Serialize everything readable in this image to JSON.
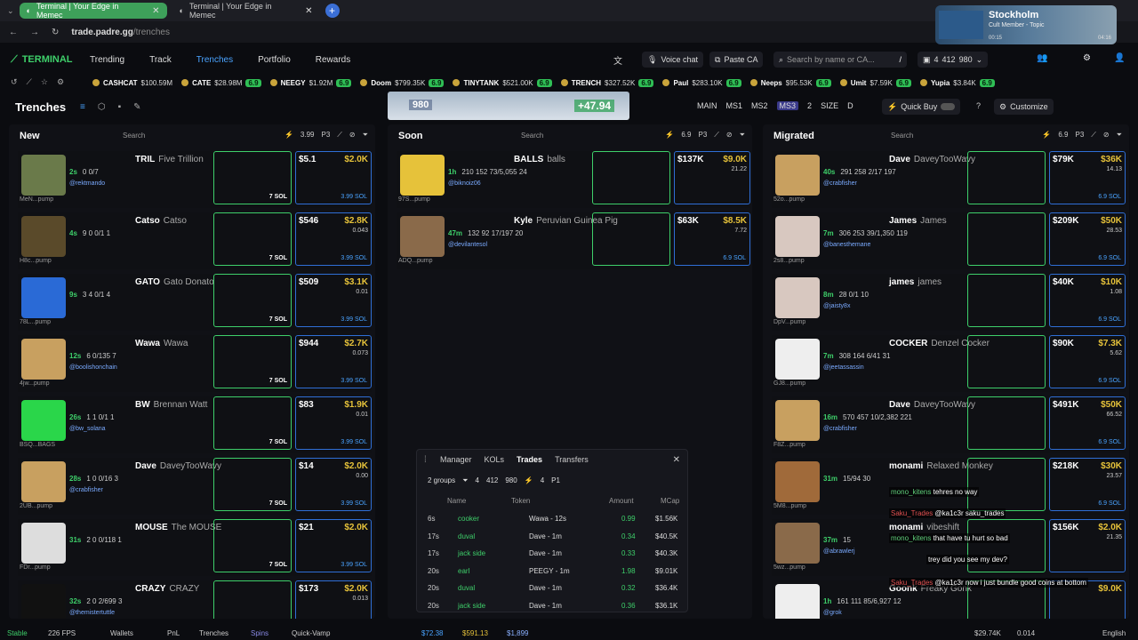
{
  "browser": {
    "tabs": [
      {
        "label": "Terminal | Your Edge in Memec"
      },
      {
        "label": "Terminal | Your Edge in Memec"
      }
    ],
    "url_host": "trade.padre.gg",
    "url_path": "/trenches",
    "media": {
      "city": "Stockholm",
      "track": "Cult Member - Topic",
      "time_start": "00:15",
      "time_end": "04:16"
    }
  },
  "nav": {
    "logo": "TERMINAL",
    "links": [
      "Trending",
      "Track",
      "Trenches",
      "Portfolio",
      "Rewards"
    ],
    "voice_chat": "Voice chat",
    "paste_ca": "Paste CA",
    "search_placeholder": "Search by name or CA...",
    "search_key": "/",
    "wallet_count": "4",
    "wallet_val1": "412",
    "wallet_val2": "980"
  },
  "ticker": [
    {
      "sym": "CASHCAT",
      "val": "$100.59M",
      "badge": ""
    },
    {
      "sym": "CATE",
      "val": "$28.98M",
      "badge": "6.9"
    },
    {
      "sym": "NEEGY",
      "val": "$1.92M",
      "badge": "6.9"
    },
    {
      "sym": "Doom",
      "val": "$799.35K",
      "badge": "6.9"
    },
    {
      "sym": "TINYTANK",
      "val": "$521.00K",
      "badge": "6.9"
    },
    {
      "sym": "TRENCH",
      "val": "$327.52K",
      "badge": "6.9"
    },
    {
      "sym": "Paul",
      "val": "$283.10K",
      "badge": "6.9"
    },
    {
      "sym": "Neeps",
      "val": "$95.53K",
      "badge": "6.9"
    },
    {
      "sym": "Umit",
      "val": "$7.59K",
      "badge": "6.9"
    },
    {
      "sym": "Yupia",
      "val": "$3.84K",
      "badge": "6.9"
    }
  ],
  "page": {
    "title": "Trenches",
    "banner_left": "980",
    "banner_right": "+47.94",
    "presets": [
      "MAIN",
      "MS1",
      "MS2",
      "MS3",
      "2",
      "SIZE",
      "D"
    ],
    "quick_buy": "Quick Buy",
    "customize": "Customize"
  },
  "columns": [
    {
      "name": "New",
      "search": "Search",
      "amt": "3.99",
      "preset": "P3",
      "cards": [
        {
          "ticker": "TRIL",
          "full": "Five Trillion",
          "age": "2s",
          "mint": "MeN...pump",
          "handle": "@rektmando",
          "v": "$5.1",
          "mc": "$2.0K",
          "fee": "",
          "sol": "7 SOL",
          "bsol": "3.99 SOL",
          "stat": "0 0/7",
          "mcolor": "#6a7a4a"
        },
        {
          "ticker": "Catso",
          "full": "Catso",
          "age": "4s",
          "mint": "H8c...pump",
          "handle": "",
          "v": "$546",
          "mc": "$2.8K",
          "fee": "0.043",
          "sol": "7 SOL",
          "bsol": "3.99 SOL",
          "stat": "9 0 0/1 1",
          "mcolor": "#5a4a2a"
        },
        {
          "ticker": "GATO",
          "full": "Gato Donato",
          "age": "9s",
          "mint": "78L...pump",
          "handle": "",
          "v": "$509",
          "mc": "$3.1K",
          "fee": "0.01",
          "sol": "7 SOL",
          "bsol": "3.99 SOL",
          "stat": "3 4 0/1 4",
          "mcolor": "#2a6ad6"
        },
        {
          "ticker": "Wawa",
          "full": "Wawa",
          "age": "12s",
          "mint": "4jw...pump",
          "handle": "@boolishonchain",
          "v": "$944",
          "mc": "$2.7K",
          "fee": "0.073",
          "sol": "7 SOL",
          "bsol": "3.99 SOL",
          "stat": "6 0/135 7",
          "mcolor": "#c8a060"
        },
        {
          "ticker": "BW",
          "full": "Brennan Watt",
          "age": "26s",
          "mint": "BSQ...BAGS",
          "handle": "@bw_solana",
          "v": "$83",
          "mc": "$1.9K",
          "fee": "0.01",
          "sol": "7 SOL",
          "bsol": "3.99 SOL",
          "stat": "1 1 0/1 1",
          "mcolor": "#2ad64a"
        },
        {
          "ticker": "Dave",
          "full": "DaveyTooWavy",
          "age": "28s",
          "mint": "2UB...pump",
          "handle": "@crabfisher",
          "v": "$14",
          "mc": "$2.0K",
          "fee": "0.00",
          "sol": "7 SOL",
          "bsol": "3.99 SOL",
          "stat": "1 0 0/16 3",
          "mcolor": "#c8a060"
        },
        {
          "ticker": "MOUSE",
          "full": "The MOUSE",
          "age": "31s",
          "mint": "FDr...pump",
          "handle": "",
          "v": "$21",
          "mc": "$2.0K",
          "fee": "",
          "sol": "7 SOL",
          "bsol": "3.99 SOL",
          "stat": "2 0 0/118 1",
          "mcolor": "#ddd"
        },
        {
          "ticker": "CRAZY",
          "full": "CRAZY",
          "age": "32s",
          "mint": "",
          "handle": "@themistertuttle",
          "v": "$173",
          "mc": "$2.0K",
          "fee": "0.013",
          "sol": "",
          "bsol": "",
          "stat": "2 0 2/699 3",
          "mcolor": "#111"
        }
      ]
    },
    {
      "name": "Soon",
      "search": "Search",
      "amt": "6.9",
      "preset": "P3",
      "cards": [
        {
          "ticker": "BALLS",
          "full": "balls",
          "age": "1h",
          "mint": "97S...pump",
          "handle": "@biknoiz06",
          "v": "$137K",
          "mc": "$9.0K",
          "fee": "21.22",
          "sol": "",
          "bsol": "",
          "stat": "210 152 73/5,055 24",
          "mcolor": "#e6c23a"
        },
        {
          "ticker": "Kyle",
          "full": "Peruvian Guinea Pig",
          "age": "47m",
          "mint": "ADQ...pump",
          "handle": "@devilantesol",
          "v": "$63K",
          "mc": "$8.5K",
          "fee": "7.72",
          "sol": "",
          "bsol": "6.9 SOL",
          "stat": "132 92 17/197 20",
          "mcolor": "#8a6a4a"
        }
      ]
    },
    {
      "name": "Migrated",
      "search": "Search",
      "amt": "6.9",
      "preset": "P3",
      "cards": [
        {
          "ticker": "Dave",
          "full": "DaveyTooWavy",
          "age": "40s",
          "mint": "52o...pump",
          "handle": "@crabfisher",
          "v": "$79K",
          "mc": "$36K",
          "fee": "14.13",
          "sol": "",
          "bsol": "6.9 SOL",
          "stat": "291 258 2/17 197",
          "mcolor": "#c8a060"
        },
        {
          "ticker": "James",
          "full": "James",
          "age": "7m",
          "mint": "2s8...pump",
          "handle": "@banesthemane",
          "v": "$209K",
          "mc": "$50K",
          "fee": "28.53",
          "sol": "",
          "bsol": "6.9 SOL",
          "stat": "306 253 39/1,350 119",
          "mcolor": "#d8c8c0"
        },
        {
          "ticker": "james",
          "full": "james",
          "age": "8m",
          "mint": "DpV...pump",
          "handle": "@jaisty8x",
          "v": "$40K",
          "mc": "$10K",
          "fee": "1.08",
          "sol": "",
          "bsol": "6.9 SOL",
          "stat": "28 0/1 10",
          "mcolor": "#d8c8c0"
        },
        {
          "ticker": "COCKER",
          "full": "Denzel Cocker",
          "age": "7m",
          "mint": "GJ8...pump",
          "handle": "@jeetassassin",
          "v": "$90K",
          "mc": "$7.3K",
          "fee": "5.62",
          "sol": "",
          "bsol": "6.9 SOL",
          "stat": "308 164 6/41 31",
          "mcolor": "#eee"
        },
        {
          "ticker": "Dave",
          "full": "DaveyTooWavy",
          "age": "16m",
          "mint": "F8Z...pump",
          "handle": "@crabfisher",
          "v": "$491K",
          "mc": "$50K",
          "fee": "66.52",
          "sol": "",
          "bsol": "6.9 SOL",
          "stat": "570 457 10/2,382 221",
          "mcolor": "#c8a060"
        },
        {
          "ticker": "monami",
          "full": "Relaxed Monkey",
          "age": "31m",
          "mint": "5M8...pump",
          "handle": "",
          "v": "$218K",
          "mc": "$30K",
          "fee": "23.57",
          "sol": "",
          "bsol": "6.9 SOL",
          "stat": "15/94 30",
          "mcolor": "#a06a3a"
        },
        {
          "ticker": "monami",
          "full": "vibeshift",
          "age": "37m",
          "mint": "5wz...pump",
          "handle": "@abrawlerj",
          "v": "$156K",
          "mc": "$2.0K",
          "fee": "21.35",
          "sol": "",
          "bsol": "",
          "stat": "15",
          "mcolor": "#8a6a4a"
        },
        {
          "ticker": "Goonk",
          "full": "Freaky Gonk",
          "age": "1h",
          "mint": "",
          "handle": "@grok",
          "v": "",
          "mc": "$9.0K",
          "fee": "",
          "sol": "",
          "bsol": "",
          "stat": "161 111 85/6,927 12",
          "mcolor": "#eee"
        }
      ]
    }
  ],
  "trades": {
    "tabs": [
      "Manager",
      "KOLs",
      "Trades",
      "Transfers"
    ],
    "groups": "2 groups",
    "f1": "4",
    "f2": "412",
    "f3": "980",
    "f4": "4",
    "preset": "P1",
    "headers": [
      "Name",
      "Token",
      "Amount",
      "MCap"
    ],
    "rows": [
      {
        "age": "6s",
        "who": "cooker",
        "tok": "Wawa - 12s",
        "amt": "0.99",
        "mcap": "$1.56K",
        "color": "#3ecf6a"
      },
      {
        "age": "17s",
        "who": "duval",
        "tok": "Dave - 1m",
        "amt": "0.34",
        "mcap": "$40.5K",
        "color": "#3ecf6a"
      },
      {
        "age": "17s",
        "who": "jack side",
        "tok": "Dave - 1m",
        "amt": "0.33",
        "mcap": "$40.3K",
        "color": "#3ecf6a"
      },
      {
        "age": "20s",
        "who": "earl",
        "tok": "PEEGY - 1m",
        "amt": "1.98",
        "mcap": "$9.01K",
        "color": "#3ecf6a"
      },
      {
        "age": "20s",
        "who": "duval",
        "tok": "Dave - 1m",
        "amt": "0.32",
        "mcap": "$36.4K",
        "color": "#3ecf6a"
      },
      {
        "age": "20s",
        "who": "jack side",
        "tok": "Dave - 1m",
        "amt": "0.36",
        "mcap": "$36.1K",
        "color": "#3ecf6a"
      }
    ]
  },
  "chat": [
    {
      "user": "mono_kitens",
      "msg": "tehres no way",
      "color": "#5fcf7a"
    },
    {
      "user": "Saku_Trades",
      "msg": "@ka1c3r saku_trades",
      "color": "#e05050"
    },
    {
      "user": "mono_kitens",
      "msg": "that have tu hurt so bad",
      "color": "#5fcf7a"
    },
    {
      "user": "",
      "msg": "trey did you see my dev?",
      "color": "#fff"
    },
    {
      "user": "Saku_Trades",
      "msg": "@ka1c3r now i just bundle good coins at bottom",
      "color": "#e05050"
    }
  ],
  "status": {
    "stable": "Stable",
    "fps": "226 FPS",
    "wallets": "Wallets",
    "pnl": "PnL",
    "trenches": "Trenches",
    "spins": "Spins",
    "quick_vamp": "Quick-Vamp",
    "sol_price": "$72.38",
    "btc_price": "$591.13",
    "eth_price": "$1,899",
    "right1": "$29.74K",
    "right2": "0.014",
    "lang": "English"
  }
}
